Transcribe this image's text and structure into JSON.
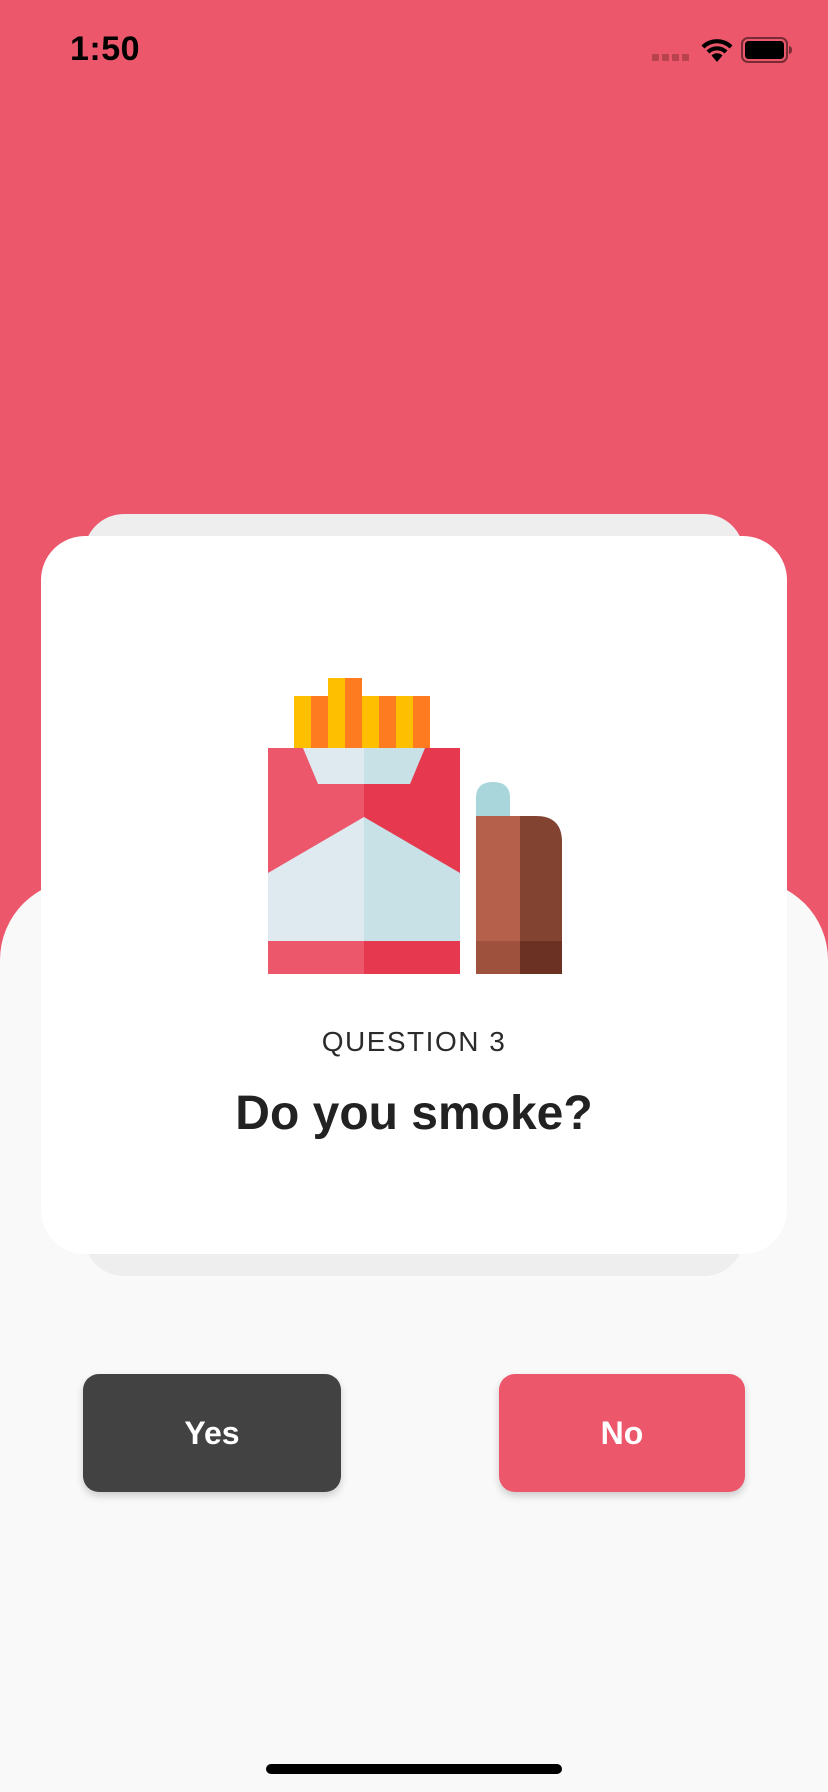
{
  "status_bar": {
    "time": "1:50"
  },
  "question": {
    "number_label": "QUESTION 3",
    "text": "Do you smoke?",
    "illustration": "cigarette-pack-and-lighter"
  },
  "answers": {
    "yes_label": "Yes",
    "no_label": "No"
  },
  "colors": {
    "accent": "#ec576b",
    "dark_button": "#424242",
    "background": "#f9f9f9",
    "card": "#ffffff"
  }
}
